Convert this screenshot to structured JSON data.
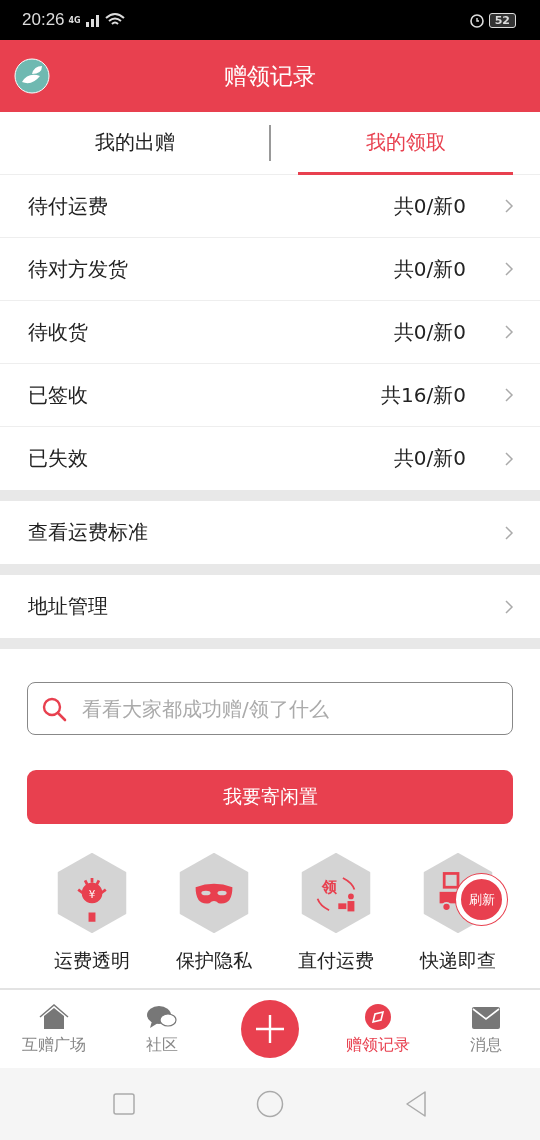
{
  "status_bar": {
    "time": "20:26",
    "network": "4G",
    "battery": "52"
  },
  "header": {
    "title": "赠领记录"
  },
  "tabs": [
    {
      "label": "我的出赠",
      "selected": false
    },
    {
      "label": "我的领取",
      "selected": true
    }
  ],
  "record_rows": [
    {
      "label": "待付运费",
      "count": "共0/新0"
    },
    {
      "label": "待对方发货",
      "count": "共0/新0"
    },
    {
      "label": "待收货",
      "count": "共0/新0"
    },
    {
      "label": "已签收",
      "count": "共16/新0"
    },
    {
      "label": "已失效",
      "count": "共0/新0"
    }
  ],
  "links": [
    {
      "label": "查看运费标准"
    },
    {
      "label": "地址管理"
    }
  ],
  "search": {
    "placeholder": "看看大家都成功赠/领了什么"
  },
  "action_button": "我要寄闲置",
  "features": [
    {
      "kind": "bulb",
      "glyph": "¥",
      "label": "运费透明"
    },
    {
      "kind": "mask",
      "label": "保护隐私"
    },
    {
      "kind": "exchange",
      "glyph": "领",
      "label": "直付运费"
    },
    {
      "kind": "truck",
      "label": "快递即查"
    }
  ],
  "refresh_badge": "刷新",
  "bottom_nav": [
    {
      "kind": "home",
      "label": "互赠广场",
      "selected": false
    },
    {
      "kind": "chat",
      "label": "社区",
      "selected": false
    },
    {
      "kind": "add"
    },
    {
      "kind": "compass",
      "label": "赠领记录",
      "selected": true
    },
    {
      "kind": "mail",
      "label": "消息",
      "selected": false
    }
  ]
}
